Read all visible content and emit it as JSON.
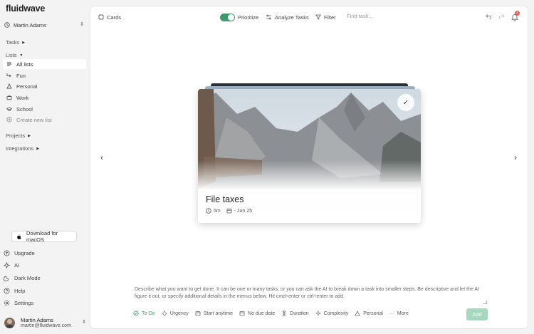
{
  "app": {
    "brand": "fluidwave"
  },
  "sidebar": {
    "workspace": "Martin Adams",
    "sections": {
      "tasks": "Tasks",
      "lists": "Lists",
      "projects": "Projects",
      "integrations": "Integrations"
    },
    "lists": [
      {
        "label": "All lists",
        "icon": "list-icon",
        "active": true
      },
      {
        "label": "Fun",
        "icon": "enter-icon"
      },
      {
        "label": "Personal",
        "icon": "triangle-icon"
      },
      {
        "label": "Work",
        "icon": "briefcase-icon"
      },
      {
        "label": "School",
        "icon": "graduation-cap-icon"
      },
      {
        "label": "Create new list",
        "icon": "plus-circle-icon"
      }
    ],
    "download": "Download for macOS",
    "bottom": [
      {
        "label": "Upgrade",
        "icon": "upgrade-icon"
      },
      {
        "label": "AI",
        "icon": "sparkle-icon"
      },
      {
        "label": "Dark Mode",
        "icon": "moon-icon"
      },
      {
        "label": "Help",
        "icon": "help-icon"
      },
      {
        "label": "Settings",
        "icon": "gear-icon"
      }
    ],
    "user": {
      "name": "Martin Adams",
      "email": "martin@fluidwave.com"
    }
  },
  "toolbar": {
    "cards": "Cards",
    "prioritize": "Prioritize",
    "analyze": "Analyze Tasks",
    "filter": "Filter",
    "search_placeholder": "Find task...",
    "notification_count": "3"
  },
  "card": {
    "title": "File taxes",
    "duration": "5m",
    "due": "- Jun 25"
  },
  "composer": {
    "prompt": "Describe what you want to get done. It can be one or many tasks, or you can ask the AI to break down a task into smaller steps. Be descriptive and let the AI figure it out, or specify additional details in the menus below. Hit cmd+enter or ctrl+enter to add.",
    "chips": {
      "todo": "To-Do",
      "urgency": "Urgency",
      "start": "Start anytime",
      "due": "No due date",
      "duration": "Duration",
      "complexity": "Complexity",
      "list": "Personal",
      "more": "More"
    },
    "add": "Add"
  },
  "colors": {
    "accent": "#3c9a6a",
    "add_button": "#a7d7be",
    "badge": "#e05a4f"
  }
}
